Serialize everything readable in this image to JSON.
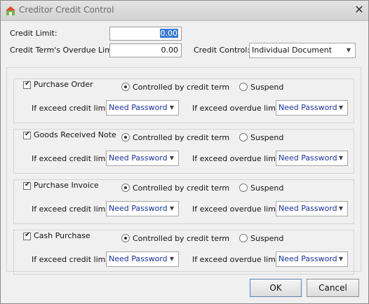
{
  "window": {
    "title": "Creditor Credit Control"
  },
  "credit_limit": {
    "label": "Credit Limit:",
    "value": "0.00"
  },
  "overdue_limit": {
    "label": "Credit Term's Overdue Limit:",
    "value": "0.00"
  },
  "credit_control": {
    "label": "Credit Control:",
    "value": "Individual Document"
  },
  "groups": [
    {
      "name": "Purchase Order",
      "checked": true,
      "controlled_label": "Controlled by credit term",
      "suspend_label": "Suspend",
      "exceed_credit_label": "If exceed credit limit:",
      "exceed_credit_value": "Need Password",
      "exceed_overdue_label": "If exceed overdue limit:",
      "exceed_overdue_value": "Need Password"
    },
    {
      "name": "Goods Received Note",
      "checked": true,
      "controlled_label": "Controlled by credit term",
      "suspend_label": "Suspend",
      "exceed_credit_label": "If exceed credit limit:",
      "exceed_credit_value": "Need Password",
      "exceed_overdue_label": "If exceed overdue limit:",
      "exceed_overdue_value": "Need Password"
    },
    {
      "name": "Purchase Invoice",
      "checked": true,
      "controlled_label": "Controlled by credit term",
      "suspend_label": "Suspend",
      "exceed_credit_label": "If exceed credit limit:",
      "exceed_credit_value": "Need Password",
      "exceed_overdue_label": "If exceed overdue limit:",
      "exceed_overdue_value": "Need Password"
    },
    {
      "name": "Cash Purchase",
      "checked": true,
      "controlled_label": "Controlled by credit term",
      "suspend_label": "Suspend",
      "exceed_credit_label": "If exceed credit limit:",
      "exceed_credit_value": "Need Password",
      "exceed_overdue_label": "If exceed overdue limit:",
      "exceed_overdue_value": "Need Password"
    }
  ],
  "buttons": {
    "ok": "OK",
    "cancel": "Cancel"
  },
  "icons": {
    "app": "app-icon",
    "close": "close-icon",
    "dropdown": "chevron-down-icon"
  }
}
